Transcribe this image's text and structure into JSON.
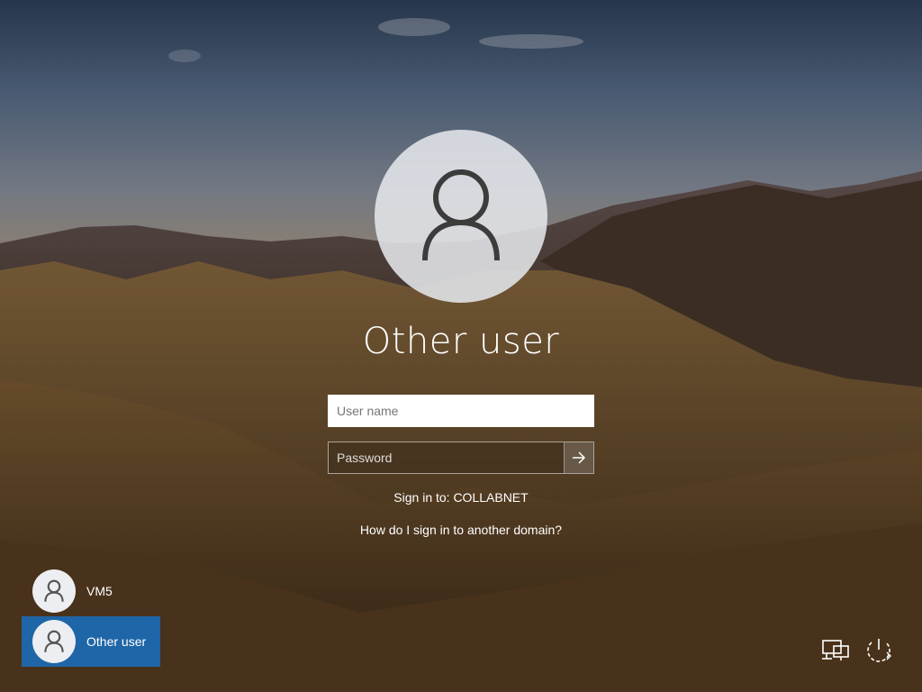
{
  "login": {
    "title": "Other user",
    "username_placeholder": "User name",
    "password_placeholder": "Password",
    "sign_in_to": "Sign in to: COLLABNET",
    "domain_help_link": "How do I sign in to another domain?"
  },
  "users": [
    {
      "name": "VM5",
      "selected": false
    },
    {
      "name": "Other user",
      "selected": true
    }
  ],
  "icons": {
    "large_avatar": "user-icon",
    "submit": "arrow-right-icon",
    "network": "network-icon",
    "power": "power-icon"
  },
  "colors": {
    "selected_user_bg": "#1f66a8",
    "text": "#ffffff"
  }
}
